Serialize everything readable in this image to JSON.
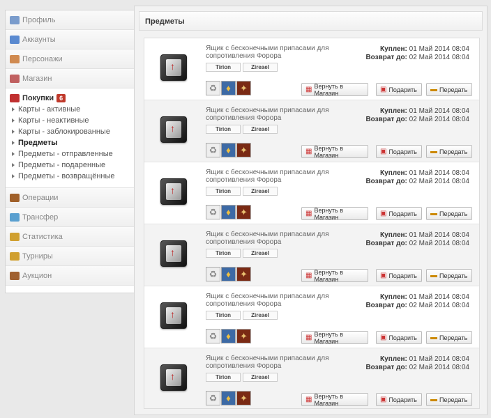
{
  "sidebar": {
    "top_items": [
      {
        "label": "Профиль",
        "icon": "profile-icon",
        "color": "#7a9ccc"
      },
      {
        "label": "Аккаунты",
        "icon": "user-icon",
        "color": "#5a8ad0"
      },
      {
        "label": "Персонажи",
        "icon": "users-icon",
        "color": "#d08a50"
      },
      {
        "label": "Магазин",
        "icon": "shop-icon",
        "color": "#c06060"
      }
    ],
    "purchases": {
      "label": "Покупки",
      "badge": "6",
      "icon": "cart-icon",
      "items": [
        {
          "label": "Карты - активные"
        },
        {
          "label": "Карты - неактивные"
        },
        {
          "label": "Карты - заблокированные"
        },
        {
          "label": "Предметы",
          "active": true
        },
        {
          "label": "Предметы - отправленные"
        },
        {
          "label": "Предметы - подаренные"
        },
        {
          "label": "Предметы - возвращённые"
        }
      ]
    },
    "bottom_items": [
      {
        "label": "Операции",
        "icon": "wallet-icon",
        "color": "#a0602a"
      },
      {
        "label": "Трансфер",
        "icon": "transfer-icon",
        "color": "#5aa0d0"
      },
      {
        "label": "Статистика",
        "icon": "chart-icon",
        "color": "#d0a030"
      },
      {
        "label": "Турниры",
        "icon": "trophy-icon",
        "color": "#d0a030"
      },
      {
        "label": "Аукцион",
        "icon": "hammer-icon",
        "color": "#a06030"
      }
    ]
  },
  "panel": {
    "title": "Предметы"
  },
  "items": [
    {
      "name": "Ящик с бесконечными припасами для сопротивления Форора",
      "tags": [
        "Tirion",
        "Zireael"
      ],
      "bought_label": "Куплен:",
      "bought": "01 Май 2014 08:04",
      "return_label": "Возврат до:",
      "return_until": "02 Май 2014 08:04"
    },
    {
      "name": "Ящик с бесконечными припасами для сопротивления Форора",
      "tags": [
        "Tirion",
        "Zireael"
      ],
      "bought_label": "Куплен:",
      "bought": "01 Май 2014 08:04",
      "return_label": "Возврат до:",
      "return_until": "02 Май 2014 08:04"
    },
    {
      "name": "Ящик с бесконечными припасами для сопротивления Форора",
      "tags": [
        "Tirion",
        "Zireael"
      ],
      "bought_label": "Куплен:",
      "bought": "01 Май 2014 08:04",
      "return_label": "Возврат до:",
      "return_until": "02 Май 2014 08:04"
    },
    {
      "name": "Ящик с бесконечными припасами для сопротивления Форора",
      "tags": [
        "Tirion",
        "Zireael"
      ],
      "bought_label": "Куплен:",
      "bought": "01 Май 2014 08:04",
      "return_label": "Возврат до:",
      "return_until": "02 Май 2014 08:04"
    },
    {
      "name": "Ящик с бесконечными припасами для сопротивления Форора",
      "tags": [
        "Tirion",
        "Zireael"
      ],
      "bought_label": "Куплен:",
      "bought": "01 Май 2014 08:04",
      "return_label": "Возврат до:",
      "return_until": "02 Май 2014 08:04"
    },
    {
      "name": "Ящик с бесконечными припасами для сопротивления Форора",
      "tags": [
        "Tirion",
        "Zireael"
      ],
      "bought_label": "Куплен:",
      "bought": "01 Май 2014 08:04",
      "return_label": "Возврат до:",
      "return_until": "02 Май 2014 08:04"
    }
  ],
  "actions": {
    "return_label": "Вернуть в Магазин",
    "gift_label": "Подарить",
    "transfer_label": "Передать"
  }
}
